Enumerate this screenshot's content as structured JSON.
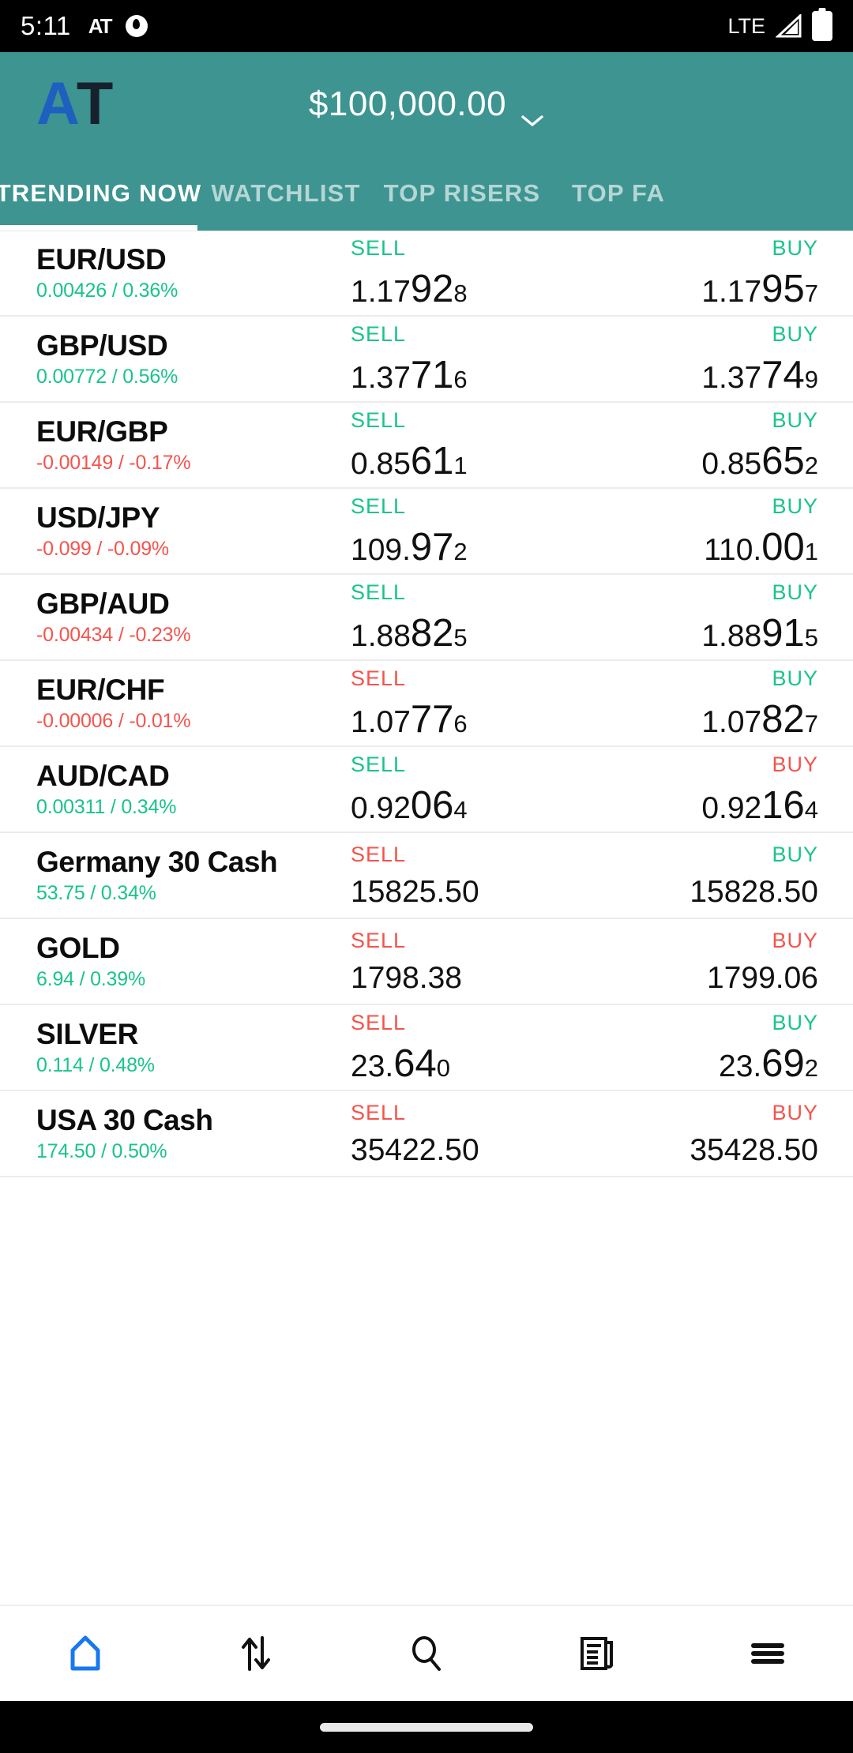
{
  "status_bar": {
    "time": "5:11",
    "app_badge": "AT",
    "network": "LTE",
    "icons": [
      "at-badge-icon",
      "app-notification-icon",
      "signal-icon",
      "battery-icon"
    ]
  },
  "header": {
    "logo_a": "A",
    "logo_t": "T",
    "balance": "$100,000.00",
    "dropdown_icon": "chevron-down-icon",
    "bg_color": "#3d9490"
  },
  "tabs": {
    "active_index": 0,
    "items": [
      {
        "label": "TRENDING NOW"
      },
      {
        "label": "WATCHLIST"
      },
      {
        "label": "TOP RISERS"
      },
      {
        "label": "TOP FA"
      }
    ]
  },
  "colors": {
    "up": "#19c48a",
    "down": "#f4544c",
    "teal": "#3d9490",
    "logo_blue": "#1f5fbf",
    "logo_navy": "#17212e",
    "nav_active": "#1877f2"
  },
  "labels": {
    "sell": "SELL",
    "buy": "BUY"
  },
  "instruments": [
    {
      "symbol": "EUR/USD",
      "mixed_case": false,
      "change": "0.00426 / 0.36%",
      "change_dir": "up",
      "sell_dir": "up",
      "buy_dir": "up",
      "sell": {
        "p1": "1.17",
        "p2": "92",
        "p3": "8"
      },
      "buy": {
        "p1": "1.17",
        "p2": "95",
        "p3": "7"
      }
    },
    {
      "symbol": "GBP/USD",
      "mixed_case": false,
      "change": "0.00772 / 0.56%",
      "change_dir": "up",
      "sell_dir": "up",
      "buy_dir": "up",
      "sell": {
        "p1": "1.37",
        "p2": "71",
        "p3": "6"
      },
      "buy": {
        "p1": "1.37",
        "p2": "74",
        "p3": "9"
      }
    },
    {
      "symbol": "EUR/GBP",
      "mixed_case": false,
      "change": "-0.00149 / -0.17%",
      "change_dir": "down",
      "sell_dir": "up",
      "buy_dir": "up",
      "sell": {
        "p1": "0.85",
        "p2": "61",
        "p3": "1"
      },
      "buy": {
        "p1": "0.85",
        "p2": "65",
        "p3": "2"
      }
    },
    {
      "symbol": "USD/JPY",
      "mixed_case": false,
      "change": "-0.099 / -0.09%",
      "change_dir": "down",
      "sell_dir": "up",
      "buy_dir": "up",
      "sell": {
        "p1": "109.",
        "p2": "97",
        "p3": "2"
      },
      "buy": {
        "p1": "110.",
        "p2": "00",
        "p3": "1"
      }
    },
    {
      "symbol": "GBP/AUD",
      "mixed_case": false,
      "change": "-0.00434 / -0.23%",
      "change_dir": "down",
      "sell_dir": "up",
      "buy_dir": "up",
      "sell": {
        "p1": "1.88",
        "p2": "82",
        "p3": "5"
      },
      "buy": {
        "p1": "1.88",
        "p2": "91",
        "p3": "5"
      }
    },
    {
      "symbol": "EUR/CHF",
      "mixed_case": false,
      "change": "-0.00006 / -0.01%",
      "change_dir": "down",
      "sell_dir": "down",
      "buy_dir": "up",
      "sell": {
        "p1": "1.07",
        "p2": "77",
        "p3": "6"
      },
      "buy": {
        "p1": "1.07",
        "p2": "82",
        "p3": "7"
      }
    },
    {
      "symbol": "AUD/CAD",
      "mixed_case": false,
      "change": "0.00311 / 0.34%",
      "change_dir": "up",
      "sell_dir": "up",
      "buy_dir": "down",
      "sell": {
        "p1": "0.92",
        "p2": "06",
        "p3": "4"
      },
      "buy": {
        "p1": "0.92",
        "p2": "16",
        "p3": "4"
      }
    },
    {
      "symbol": "Germany 30 Cash",
      "mixed_case": true,
      "change": "53.75 / 0.34%",
      "change_dir": "up",
      "sell_dir": "down",
      "buy_dir": "up",
      "sell": {
        "p1": "15825.50",
        "p2": "",
        "p3": ""
      },
      "buy": {
        "p1": "15828.50",
        "p2": "",
        "p3": ""
      }
    },
    {
      "symbol": "GOLD",
      "mixed_case": false,
      "change": "6.94 / 0.39%",
      "change_dir": "up",
      "sell_dir": "down",
      "buy_dir": "down",
      "sell": {
        "p1": "1798.38",
        "p2": "",
        "p3": ""
      },
      "buy": {
        "p1": "1799.06",
        "p2": "",
        "p3": ""
      }
    },
    {
      "symbol": "SILVER",
      "mixed_case": false,
      "change": "0.114 / 0.48%",
      "change_dir": "up",
      "sell_dir": "down",
      "buy_dir": "up",
      "sell": {
        "p1": "23.",
        "p2": "64",
        "p3": "0"
      },
      "buy": {
        "p1": "23.",
        "p2": "69",
        "p3": "2"
      }
    },
    {
      "symbol": "USA 30 Cash",
      "mixed_case": true,
      "change": "174.50 / 0.50%",
      "change_dir": "up",
      "sell_dir": "down",
      "buy_dir": "down",
      "sell": {
        "p1": "35422.50",
        "p2": "",
        "p3": ""
      },
      "buy": {
        "p1": "35428.50",
        "p2": "",
        "p3": ""
      }
    }
  ],
  "bottom_nav": {
    "active_index": 0,
    "items": [
      {
        "icon": "home-icon"
      },
      {
        "icon": "trade-arrows-icon"
      },
      {
        "icon": "search-icon"
      },
      {
        "icon": "news-icon"
      },
      {
        "icon": "menu-icon"
      }
    ]
  }
}
